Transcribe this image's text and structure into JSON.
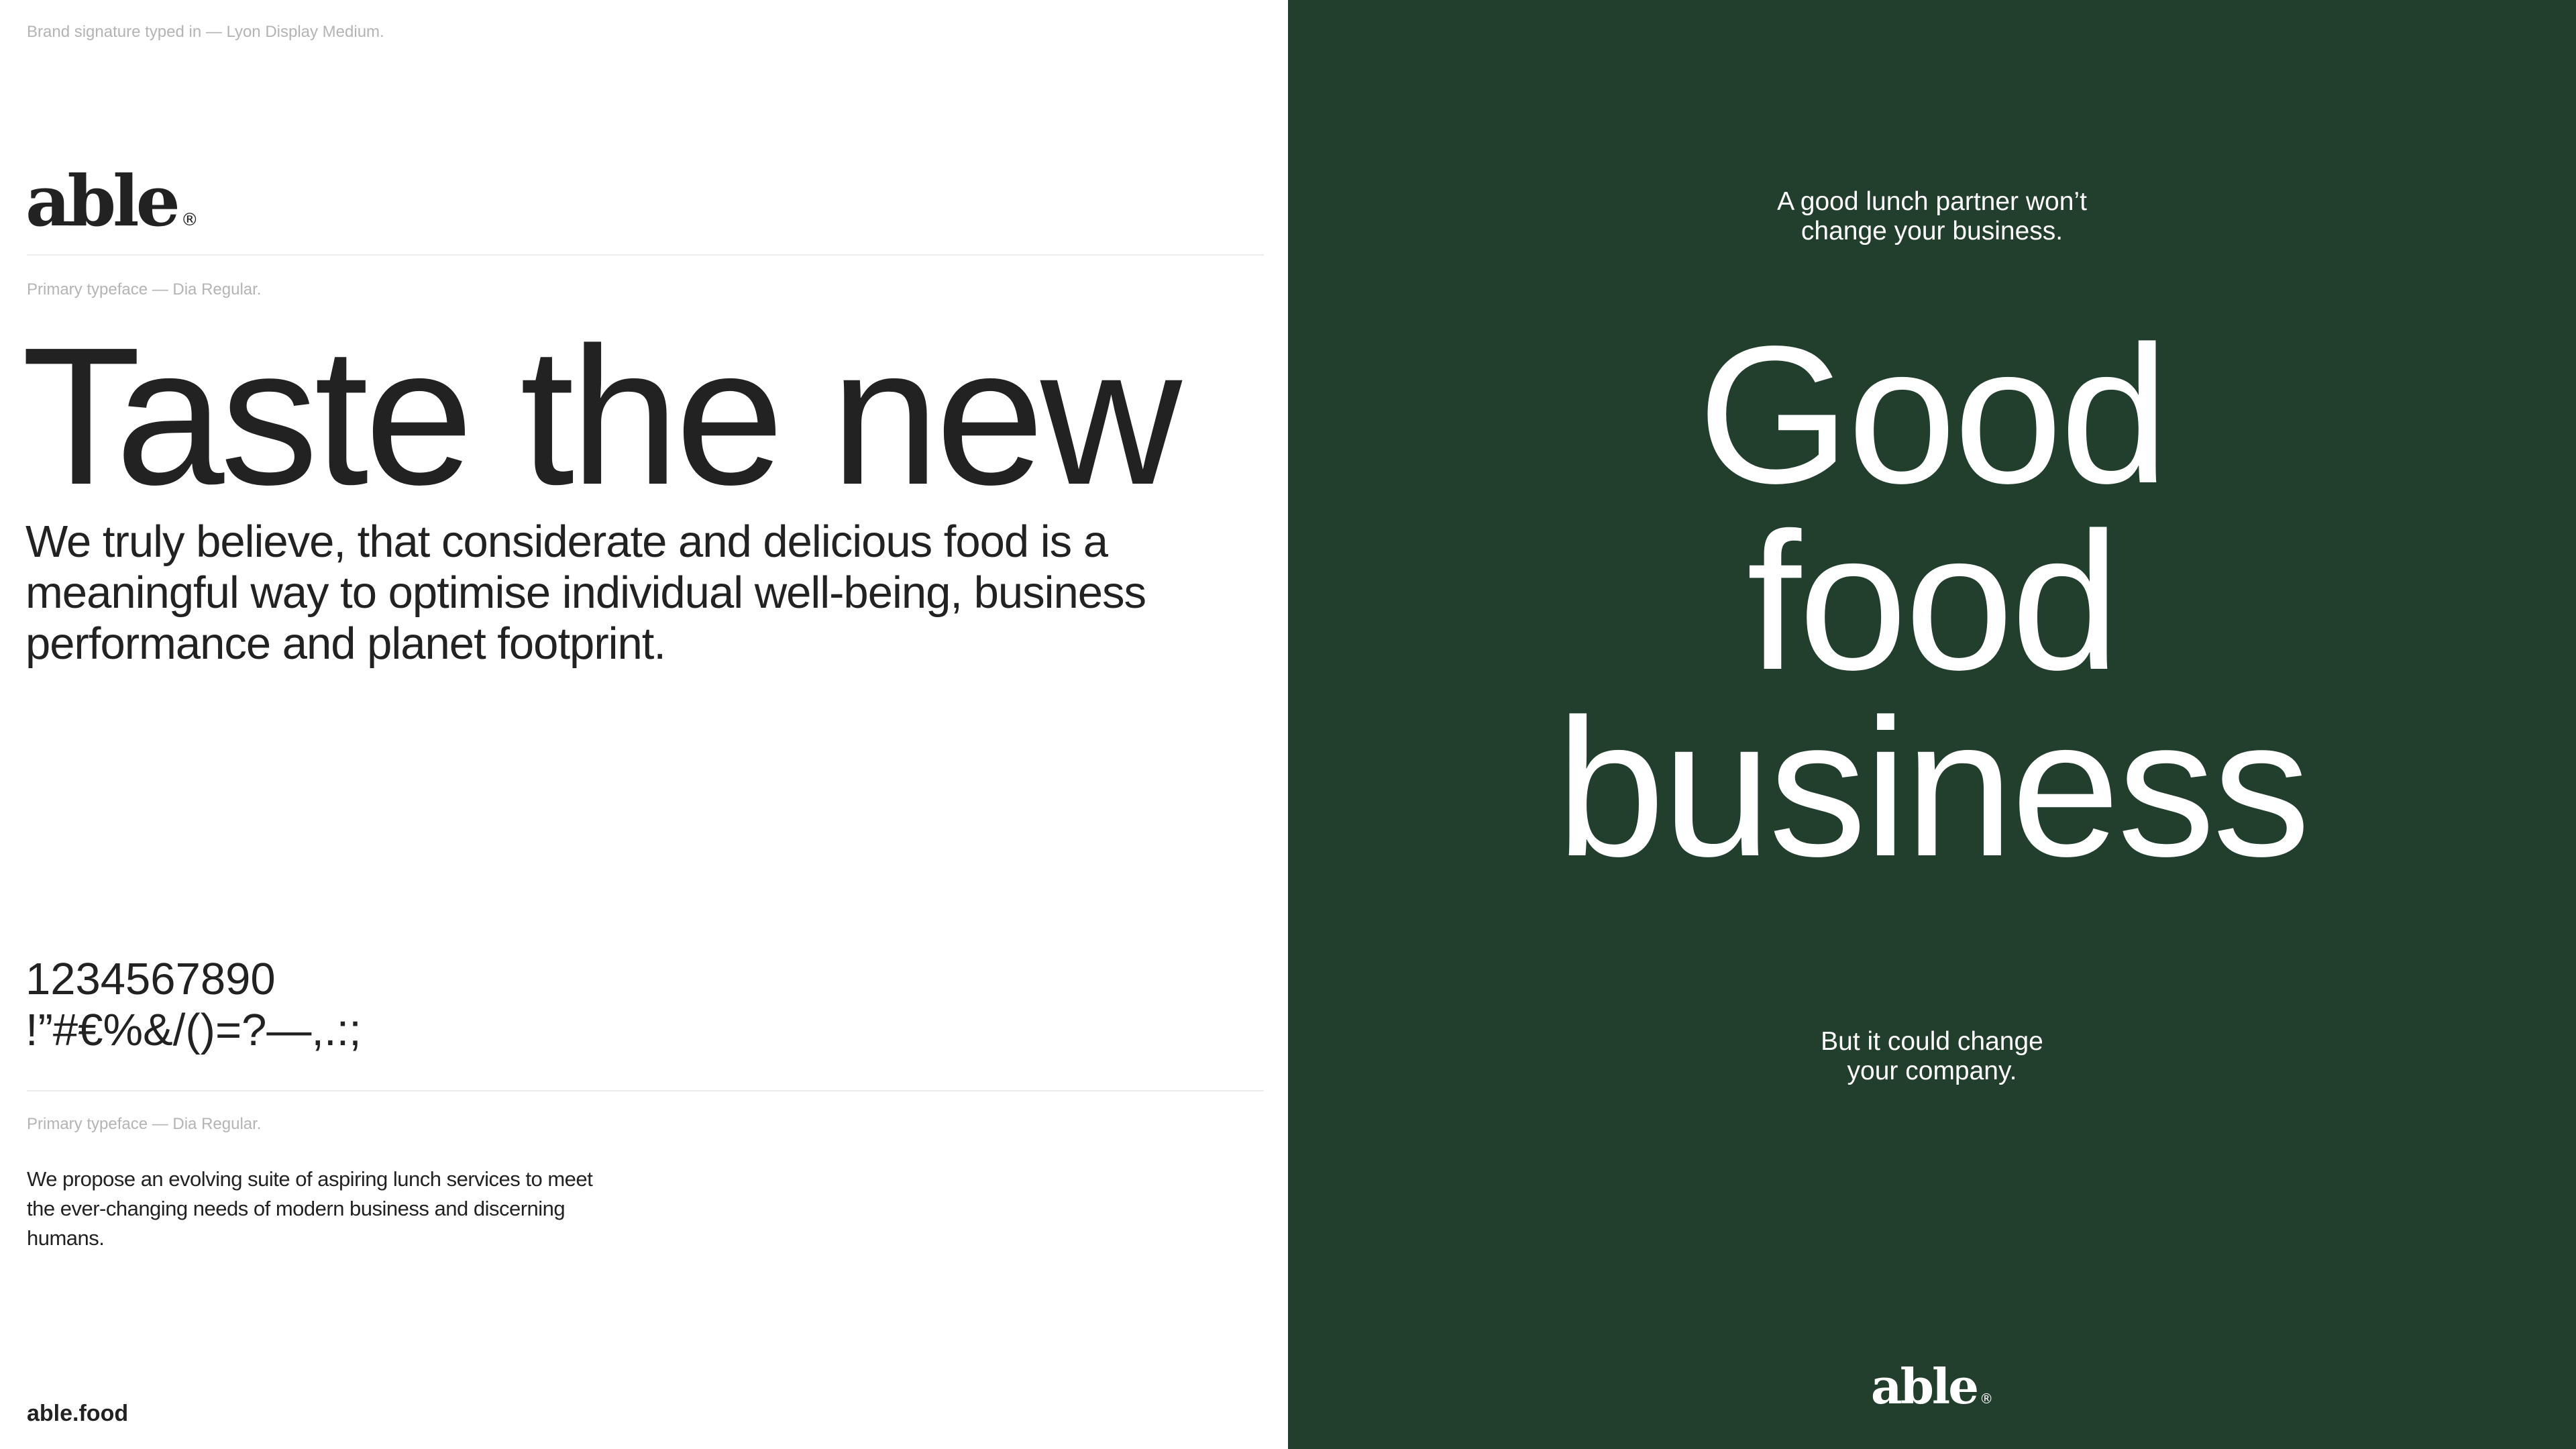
{
  "left": {
    "caption_signature": "Brand signature typed in — Lyon Display Medium.",
    "logo_text": "able",
    "logo_mark": "®",
    "caption_primary_1": "Primary typeface — Dia Regular.",
    "display_heading": "Taste the new",
    "lead_text": "We truly believe, that considerate and delicious food is a meaningful way to optimise individual well-being, business performance and planet footprint.",
    "numerals": "1234567890",
    "punctuation": "!”#€%&/()=?—,.:;",
    "caption_primary_2": "Primary typeface — Dia Regular.",
    "body_text": "We propose an evolving suite of aspiring lunch services to meet the ever-changing needs of modern business and discerning humans.",
    "footer_url": "able.food"
  },
  "right": {
    "tagline_top_line1": "A good lunch partner won’t",
    "tagline_top_line2": "change your business.",
    "hero_line1": "Good",
    "hero_line2": "food",
    "hero_line3": "business",
    "tagline_bottom_line1": "But it could change",
    "tagline_bottom_line2": "your company.",
    "logo_text": "able",
    "logo_mark": "®"
  },
  "colors": {
    "ink": "#222222",
    "brand_green": "#223e2c",
    "caption_grey": "#b4b4b4",
    "rule": "#ececec",
    "white": "#ffffff"
  }
}
